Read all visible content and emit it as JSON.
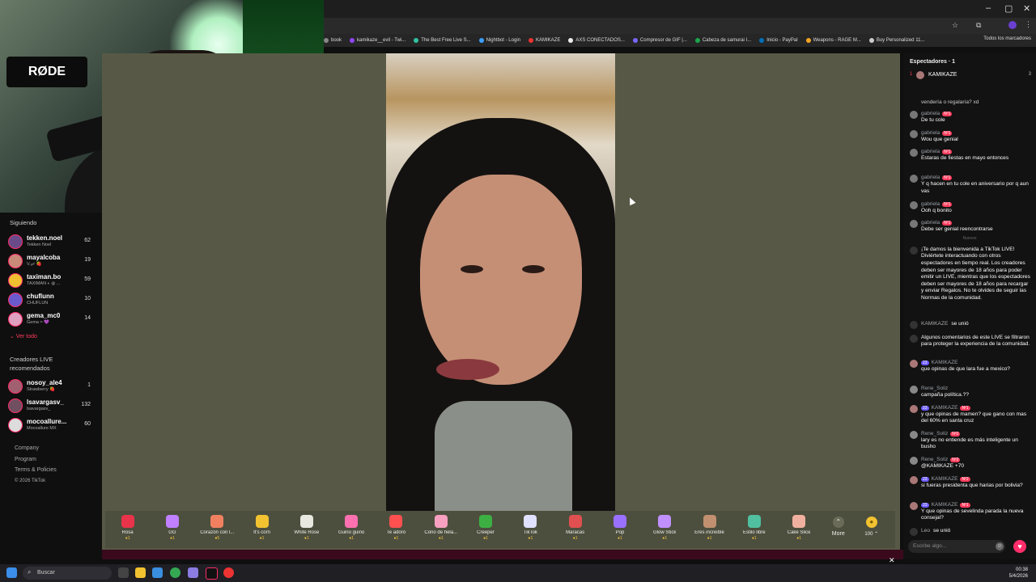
{
  "window": {
    "minimize": "–",
    "maximize": "▢",
    "close": "✕"
  },
  "bookmarks": [
    {
      "label": "book",
      "color": "#888"
    },
    {
      "label": "kamikaze__evil - Twi...",
      "color": "#9146ff"
    },
    {
      "label": "The Best Free Live S...",
      "color": "#31c3a2"
    },
    {
      "label": "Nightbot - Login",
      "color": "#3aa0ff"
    },
    {
      "label": "KAMIKAZE",
      "color": "#e33"
    },
    {
      "label": "AXS CONECTADOS...",
      "color": "#eee"
    },
    {
      "label": "Compresor de GIF |...",
      "color": "#7766ff"
    },
    {
      "label": "Cabeza de samurai I...",
      "color": "#1aa64b"
    },
    {
      "label": "Inicio - PayPal",
      "color": "#0070ba"
    },
    {
      "label": "Weapons - RAGE M...",
      "color": "#f5a623"
    },
    {
      "label": "Buy Personalized 11...",
      "color": "#ccc"
    }
  ],
  "bookmarks_all": "Todos los marcadores",
  "cam": {
    "brand": "RØDE"
  },
  "sidebar": {
    "following_title": "Siguiendo",
    "following": [
      {
        "name": "tekken.noel",
        "sub": "Tekken Noel",
        "count": "62",
        "color": "#6a4b8a"
      },
      {
        "name": "mayalcoba",
        "sub": "V.ₐ⌿ 🍓",
        "count": "19",
        "color": "#c98a7a"
      },
      {
        "name": "taximan.bo",
        "sub": "TAXIMAN ◐ ◍ ...",
        "count": "59",
        "color": "#f0c030"
      },
      {
        "name": "chuflunn",
        "sub": "CHUFLUN",
        "count": "10",
        "color": "#6a5acd"
      },
      {
        "name": "gema_mc0",
        "sub": "Gema ≈ 💜",
        "count": "14",
        "color": "#e0a0c0"
      }
    ],
    "see_all": "⌄ Ver todo",
    "recommended_title": "Creadores LIVE recomendados",
    "recommended": [
      {
        "name": "nosoy_ale4",
        "sub": "Strawberry 🍓",
        "count": "1",
        "color": "#a06070"
      },
      {
        "name": "lsavargasv_",
        "sub": "lsavargasv_",
        "count": "132",
        "color": "#705060"
      },
      {
        "name": "mocoallure...",
        "sub": "Mocoallure MX",
        "count": "60",
        "color": "#dddddd"
      }
    ],
    "footer": [
      "Company",
      "Program",
      "Terms & Policies",
      "© 2026 TikTok"
    ]
  },
  "gifts": [
    {
      "label": "Rosa",
      "price": "1",
      "color": "#e8334a"
    },
    {
      "label": "GG",
      "price": "1",
      "color": "#c080ff"
    },
    {
      "label": "Corazón con l...",
      "price": "5",
      "color": "#f08060"
    },
    {
      "label": "It's corn",
      "price": "1",
      "color": "#f2c230"
    },
    {
      "label": "White Rose",
      "price": "1",
      "color": "#e8e8e0"
    },
    {
      "label": "Guiño guiño",
      "price": "1",
      "color": "#ff70b0"
    },
    {
      "label": "Te adoro",
      "price": "1",
      "color": "#ff5050"
    },
    {
      "label": "Cono de hela...",
      "price": "1",
      "color": "#f8a0c0"
    },
    {
      "label": "Creeper",
      "price": "1",
      "color": "#3cb043"
    },
    {
      "label": "TikTok",
      "price": "1",
      "color": "#e0e0ff"
    },
    {
      "label": "Maracas",
      "price": "1",
      "color": "#e05050"
    },
    {
      "label": "Pop",
      "price": "1",
      "color": "#9a70ff"
    },
    {
      "label": "Glow Stick",
      "price": "1",
      "color": "#c090ff"
    },
    {
      "label": "Eres increíble",
      "price": "1",
      "color": "#c09070"
    },
    {
      "label": "Estilo libre",
      "price": "1",
      "color": "#50c0a0"
    },
    {
      "label": "Cake Slice",
      "price": "1",
      "color": "#f0b0a0"
    }
  ],
  "more_label": "More",
  "coins_label": "100 ⌃",
  "chat": {
    "viewers_title": "Espectadores · 1",
    "viewer_rank": "1",
    "viewer_name": "KAMIKAZE",
    "viewer_count": "3",
    "lines": [
      {
        "type": "text-only",
        "text": "vendería o regalaría? xd"
      },
      {
        "type": "msg",
        "name": "gabriela",
        "badge": "Nº1",
        "text": "De tu cole"
      },
      {
        "type": "msg",
        "name": "gabriela",
        "badge": "Nº1",
        "text": "Wou que genial"
      },
      {
        "type": "msg",
        "name": "gabriela",
        "badge": "Nº1",
        "text": "Estaras de fiestas en mayo entonces"
      },
      {
        "type": "msg",
        "name": "gabriela",
        "badge": "Nº1",
        "text": "Y q hacen en tu cole en aniversario por q aun vas"
      },
      {
        "type": "msg",
        "name": "gabriela",
        "badge": "Nº1",
        "text": "Ooh q bonito"
      },
      {
        "type": "msg",
        "name": "gabriela",
        "badge": "Nº1",
        "text": "Debe ser genial reencontrarse"
      }
    ],
    "divider": "Nuevos",
    "welcome": "¡Te damos la bienvenida a TikTok LIVE! Diviértete interactuando con otros espectadores en tiempo real. Los creadores deben ser mayores de 18 años para poder emitir un LIVE, mientras que los espectadores deben ser mayores de 18 años para recargar y enviar Regalos. No te olvides de seguir las Normas de la comunidad.",
    "joined_name": "KAMIKAZE",
    "joined_text": "se unió",
    "filtered": "Algunos comentarios de este LIVE se filtraron para proteger la experiencia de la comunidad.",
    "lines2": [
      {
        "name": "KAMIKAZE",
        "lv": "23",
        "badge": "",
        "text": "que opinas de que lara fue a mexico?"
      },
      {
        "name": "Rene_Soliz",
        "lv": "",
        "badge": "",
        "text": "campaña política.??"
      },
      {
        "name": "KAMIKAZE",
        "lv": "23",
        "badge": "Nº1",
        "text": "y que opinas de mamen? que gano con mas del 60% en santa cruz"
      },
      {
        "name": "Rene_Soliz",
        "lv": "",
        "badge": "Nº2",
        "text": "lary es no entiende es más inteligente un busho"
      },
      {
        "name": "Rene_Soliz",
        "lv": "",
        "badge": "Nº2",
        "text": "@KAMIKAZE +70"
      },
      {
        "name": "KAMIKAZE",
        "lv": "23",
        "badge": "Nº2",
        "text": "si fueras presidenta que harias por bolivia?"
      },
      {
        "name": "KAMIKAZE",
        "lv": "23",
        "badge": "Nº1",
        "text": "Y que opinas de sevelinda parada la nueva consejal?"
      }
    ],
    "last_name": "Leo",
    "last_text": "se unió",
    "input_placeholder": "Escribe algo...",
    "heart": "♥"
  },
  "taskbar": {
    "search": "Buscar",
    "time": "00:38",
    "date": "5/4/2026"
  },
  "close_x": "✕"
}
